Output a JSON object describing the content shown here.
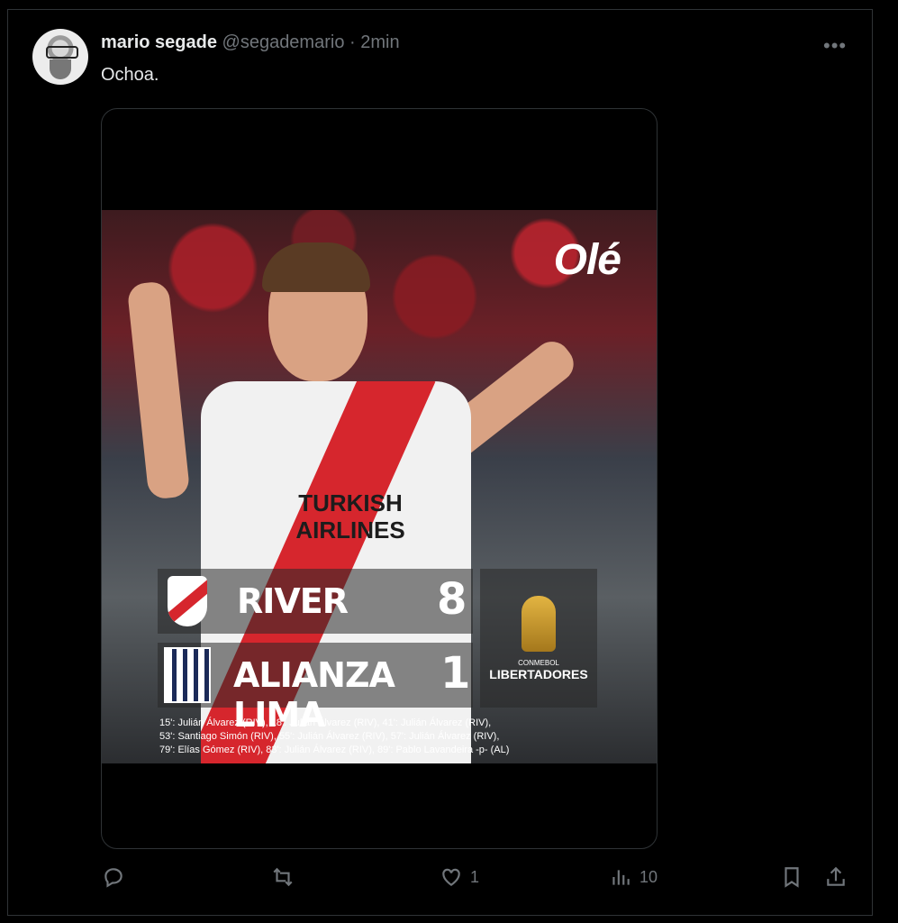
{
  "tweet": {
    "name": "mario segade",
    "handle": "@segademario",
    "separator": "·",
    "time": "2min",
    "text": "Ochoa."
  },
  "media": {
    "brand": "Olé",
    "sponsor_line1": "TURKISH",
    "sponsor_line2": "AIRLINES",
    "score": {
      "team1": "RIVER",
      "goals1": "8",
      "team2": "ALIANZA LIMA",
      "goals2": "1",
      "competition_top": "CONMEBOL",
      "competition": "LIBERTADORES"
    },
    "scorers": [
      "15': Julián Álvarez (RIV), 18': Julián Álvarez (RIV), 41': Julián Álvarez (RIV),",
      "53': Santiago Simón (RIV), 55': Julián Álvarez (RIV), 57': Julián Álvarez (RIV),",
      "79': Elías Gómez (RIV), 83': Julián Álvarez (RIV), 89': Pablo Lavandeira -p- (AL)"
    ]
  },
  "actions": {
    "reply": "",
    "retweet": "",
    "likes": "1",
    "views": "10"
  },
  "icons": [
    "more-icon",
    "reply-icon",
    "retweet-icon",
    "like-icon",
    "views-icon",
    "bookmark-icon",
    "share-icon"
  ]
}
